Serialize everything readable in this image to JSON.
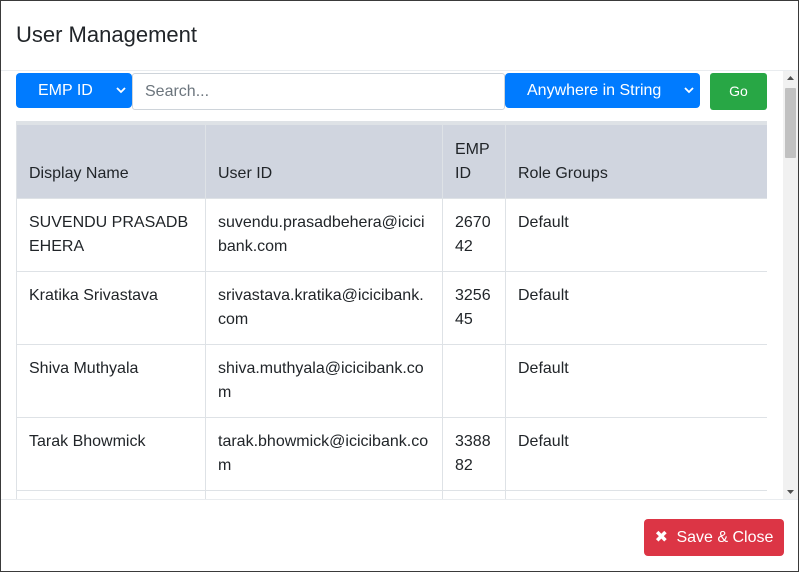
{
  "modal": {
    "title": "User Management"
  },
  "toolbar": {
    "field_select": "EMP ID",
    "search_placeholder": "Search...",
    "match_select": "Anywhere in String",
    "go_label": "Go"
  },
  "table": {
    "headers": [
      "Display Name",
      "User ID",
      "EMP ID",
      "Role Groups"
    ],
    "rows": [
      [
        "SUVENDU PRASADBEHERA",
        "suvendu.prasadbehera@icicibank.com",
        "267042",
        "Default"
      ],
      [
        "Kratika Srivastava",
        "srivastava.kratika@icicibank.com",
        "325645",
        "Default"
      ],
      [
        "Shiva Muthyala",
        "shiva.muthyala@icicibank.com",
        "",
        "Default"
      ],
      [
        "Tarak Bhowmick",
        "tarak.bhowmick@icicibank.com",
        "338882",
        "Default"
      ],
      [
        "",
        "",
        "",
        ""
      ]
    ]
  },
  "footer": {
    "save_close_label": "Save & Close",
    "save_icon": "times-icon"
  },
  "colors": {
    "primary": "#007bff",
    "success": "#28a745",
    "danger": "#dc3545",
    "table_header_bg": "#d0d5df"
  }
}
